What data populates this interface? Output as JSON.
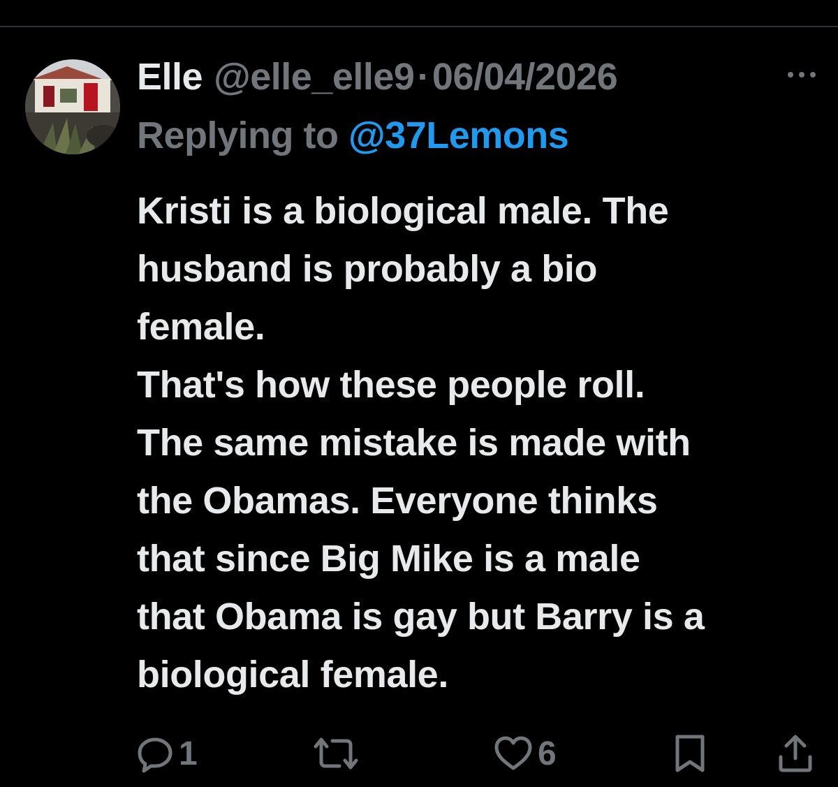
{
  "tweet": {
    "author": {
      "display_name": "Elle",
      "handle": "@elle_elle9"
    },
    "separator": "·",
    "date": "06/04/2026",
    "reply": {
      "prefix": "Replying to",
      "to_handle": "@37Lemons"
    },
    "text_lines": [
      "Kristi is a biological male. The",
      "husband is probably a bio",
      "female.",
      "That's how these people roll.",
      "The same mistake is made with",
      "the Obamas. Everyone thinks",
      "that since Big Mike is a male",
      "that Obama is gay but Barry is a",
      "biological female."
    ],
    "actions": {
      "reply_count": "1",
      "like_count": "6"
    }
  },
  "icons": {
    "avatar": "avatar-photo",
    "more": "more-icon",
    "reply": "reply-icon",
    "repost": "repost-icon",
    "like": "heart-icon",
    "bookmark": "bookmark-icon",
    "share": "share-icon"
  },
  "colors": {
    "background": "#000000",
    "primary_text": "#e7e9ea",
    "secondary_text": "#71767b",
    "link": "#1d9bf0",
    "divider": "#2f3336"
  }
}
